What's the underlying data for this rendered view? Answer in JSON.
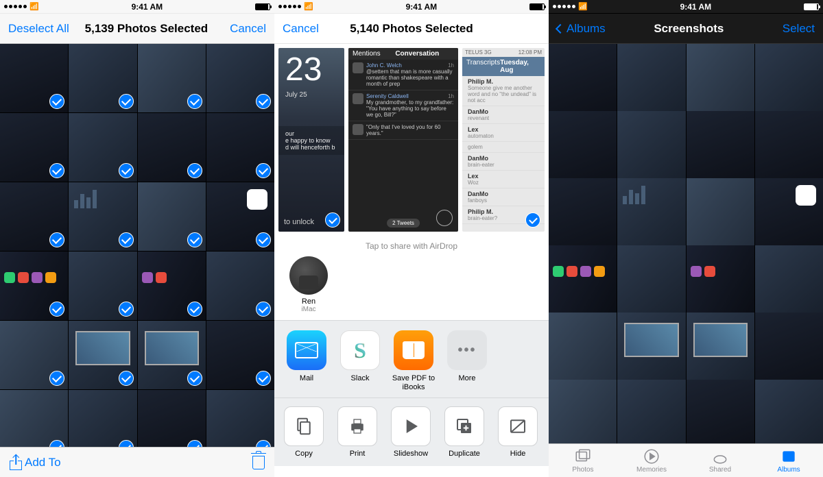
{
  "status": {
    "time": "9:41 AM"
  },
  "screen1": {
    "nav": {
      "left": "Deselect All",
      "title": "5,139 Photos Selected",
      "right": "Cancel"
    },
    "toolbar": {
      "addto": "Add To"
    }
  },
  "screen2": {
    "nav": {
      "left": "Cancel",
      "title": "5,140 Photos Selected"
    },
    "thumbs": {
      "t1": {
        "bignum": "23",
        "date": "July 25",
        "msg_title": "our",
        "msg_l1": "e happy to know",
        "msg_l2": "d will henceforth b",
        "unlock": "to unlock"
      },
      "t2": {
        "header_left": "Mentions",
        "header_title": "Conversation",
        "rows": [
          {
            "name": "John C. Welch",
            "time": "1h",
            "text": "@settern that man is more casually romantic than shakespeare with a month of prep"
          },
          {
            "name": "Serenity Caldwell",
            "time": "1h",
            "text": "My grandmother, to my grandfather: \"You have anything to say before we go, Bill?\""
          },
          {
            "name": "",
            "time": "",
            "text": "\"Only that I've loved you for 60 years.\""
          }
        ],
        "pill": "2 Tweets"
      },
      "t3": {
        "carrier": "TELUS 3G",
        "time": "12:08 PM",
        "header_left": "Transcripts",
        "header_title": "Tuesday, Aug",
        "rows": [
          {
            "name": "Philip M.",
            "sub": "Someone give me another word and no \"the undead\" is not acc"
          },
          {
            "name": "DanMo",
            "sub": "revenant"
          },
          {
            "name": "Lex",
            "sub": "automaton"
          },
          {
            "name": "",
            "sub": "golem"
          },
          {
            "name": "DanMo",
            "sub": "brain-eater"
          },
          {
            "name": "Lex",
            "sub": "Woz"
          },
          {
            "name": "DanMo",
            "sub": "fanboys"
          },
          {
            "name": "Philip M.",
            "sub": "brain-eater?"
          }
        ]
      }
    },
    "airdrop_hint": "Tap to share with AirDrop",
    "contact": {
      "name": "Ren",
      "sub": "iMac"
    },
    "apps": [
      {
        "key": "mail",
        "label": "Mail"
      },
      {
        "key": "slack",
        "label": "Slack"
      },
      {
        "key": "ibooks",
        "label": "Save PDF to iBooks"
      },
      {
        "key": "more",
        "label": "More"
      }
    ],
    "actions": [
      {
        "key": "copy",
        "label": "Copy"
      },
      {
        "key": "print",
        "label": "Print"
      },
      {
        "key": "slideshow",
        "label": "Slideshow"
      },
      {
        "key": "duplicate",
        "label": "Duplicate"
      },
      {
        "key": "hide",
        "label": "Hide"
      }
    ]
  },
  "screen3": {
    "nav": {
      "back": "Albums",
      "title": "Screenshots",
      "right": "Select"
    },
    "tabs": [
      {
        "key": "photos",
        "label": "Photos"
      },
      {
        "key": "memories",
        "label": "Memories"
      },
      {
        "key": "shared",
        "label": "Shared"
      },
      {
        "key": "albums",
        "label": "Albums"
      }
    ],
    "active_tab": "albums"
  }
}
